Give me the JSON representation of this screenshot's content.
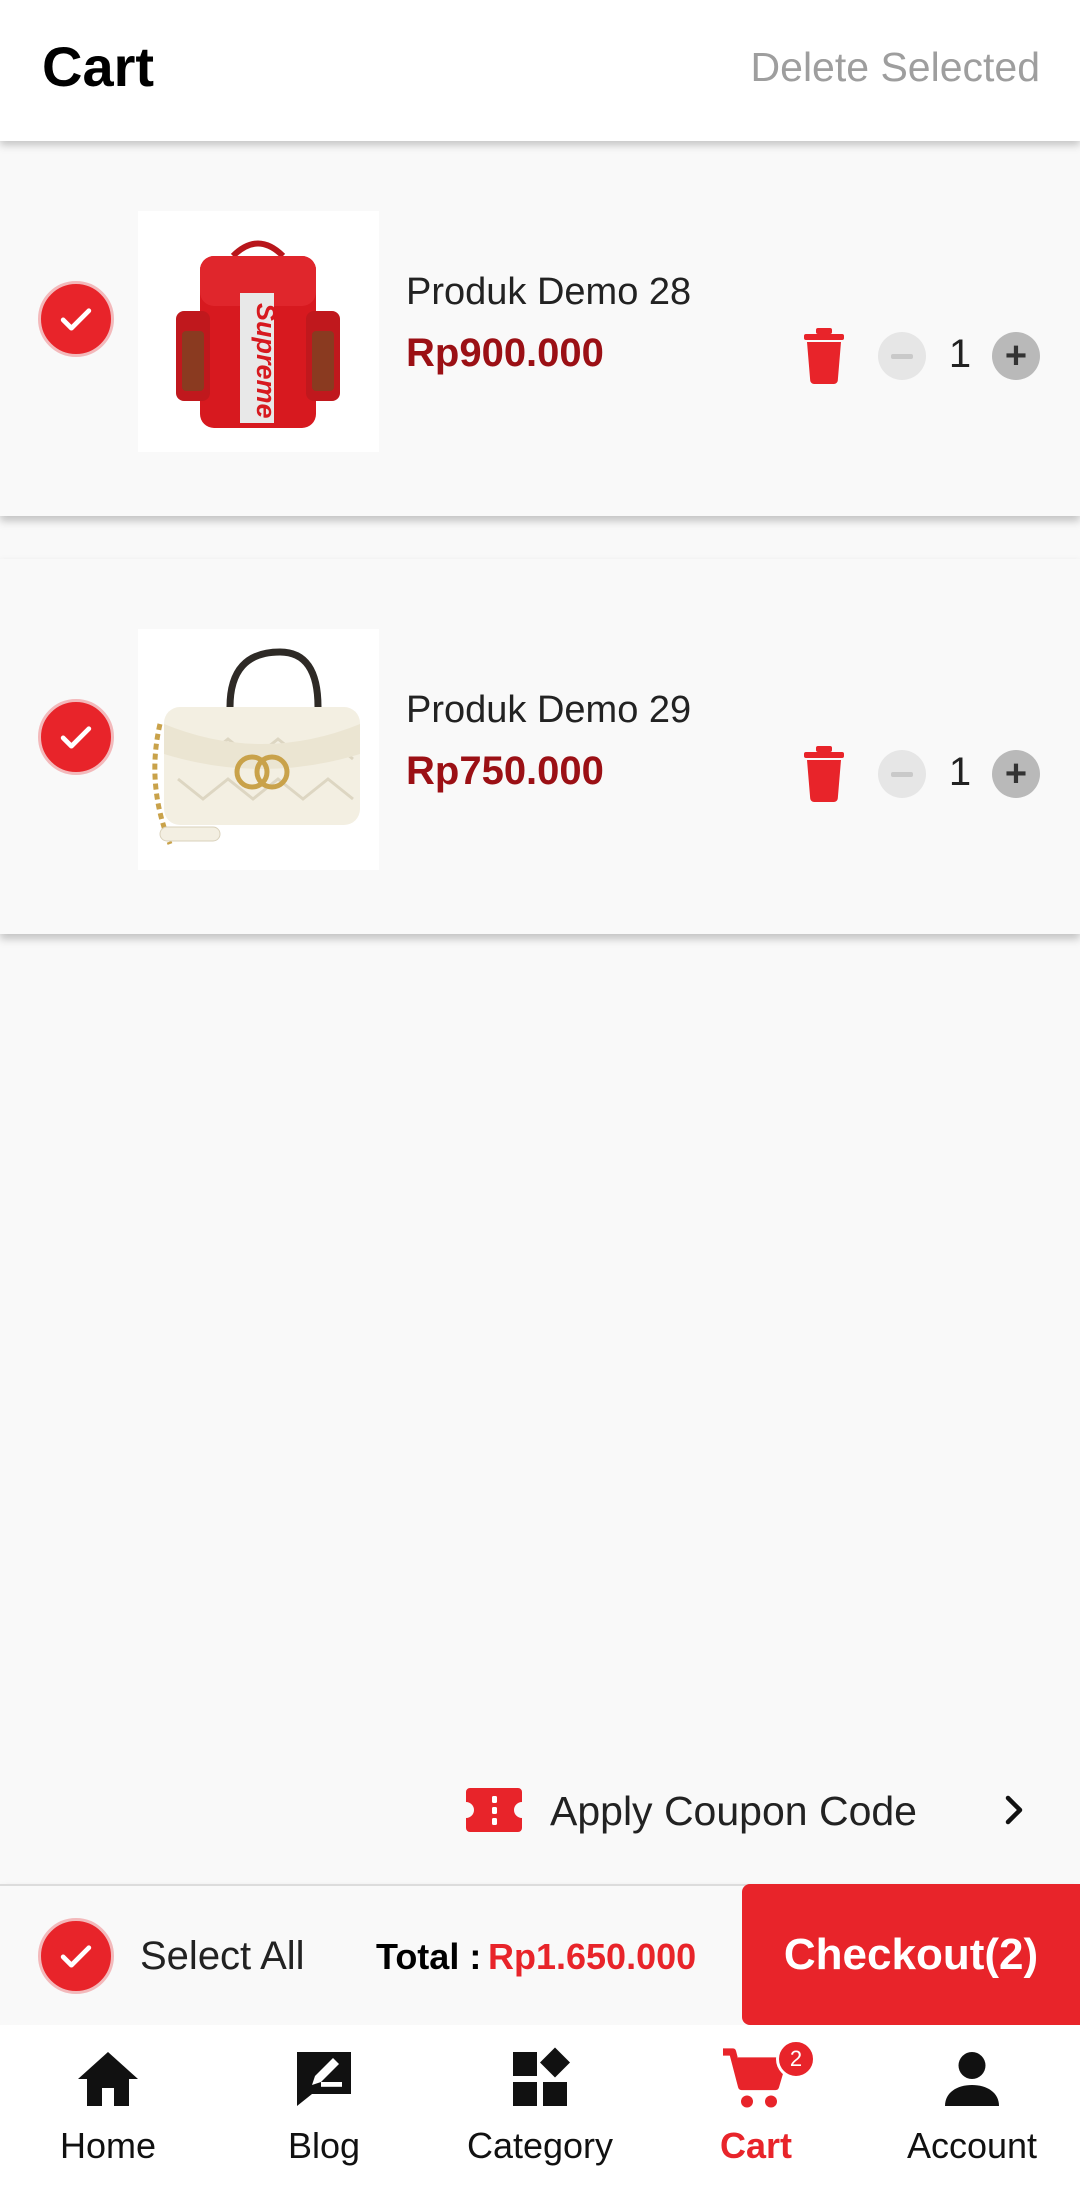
{
  "header": {
    "title": "Cart",
    "delete_selected": "Delete Selected"
  },
  "cart_items": [
    {
      "name": "Produk Demo 28",
      "price": "Rp900.000",
      "quantity": "1",
      "selected": true,
      "image_text": "Supreme"
    },
    {
      "name": "Produk Demo 29",
      "price": "Rp750.000",
      "quantity": "1",
      "selected": true
    }
  ],
  "coupon": {
    "label": "Apply Coupon Code"
  },
  "summary": {
    "select_all": "Select All",
    "total_label": "Total :",
    "total_value": "Rp1.650.000",
    "checkout_label": "Checkout(2)"
  },
  "bottom_nav": {
    "items": [
      {
        "label": "Home",
        "icon": "home-icon"
      },
      {
        "label": "Blog",
        "icon": "blog-edit-icon"
      },
      {
        "label": "Category",
        "icon": "category-icon"
      },
      {
        "label": "Cart",
        "icon": "cart-icon",
        "badge": "2",
        "active": true
      },
      {
        "label": "Account",
        "icon": "account-icon"
      }
    ]
  },
  "colors": {
    "accent": "#e8242a",
    "price": "#9b1015",
    "muted": "#9e9e9e"
  }
}
